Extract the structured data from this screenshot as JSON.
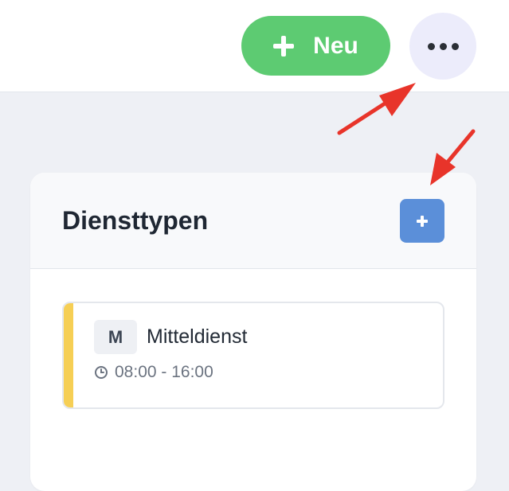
{
  "header": {
    "new_button_label": "Neu",
    "more_icon": "more-horizontal-icon"
  },
  "card": {
    "title": "Diensttypen",
    "add_icon": "plus-icon",
    "shift_types": [
      {
        "code": "M",
        "name": "Mitteldienst",
        "time": "08:00 - 16:00",
        "color": "#f6cf55"
      }
    ]
  },
  "colors": {
    "new_button": "#5dcb72",
    "add_button": "#5b8fd9",
    "annotation_arrow": "#e8342a"
  }
}
